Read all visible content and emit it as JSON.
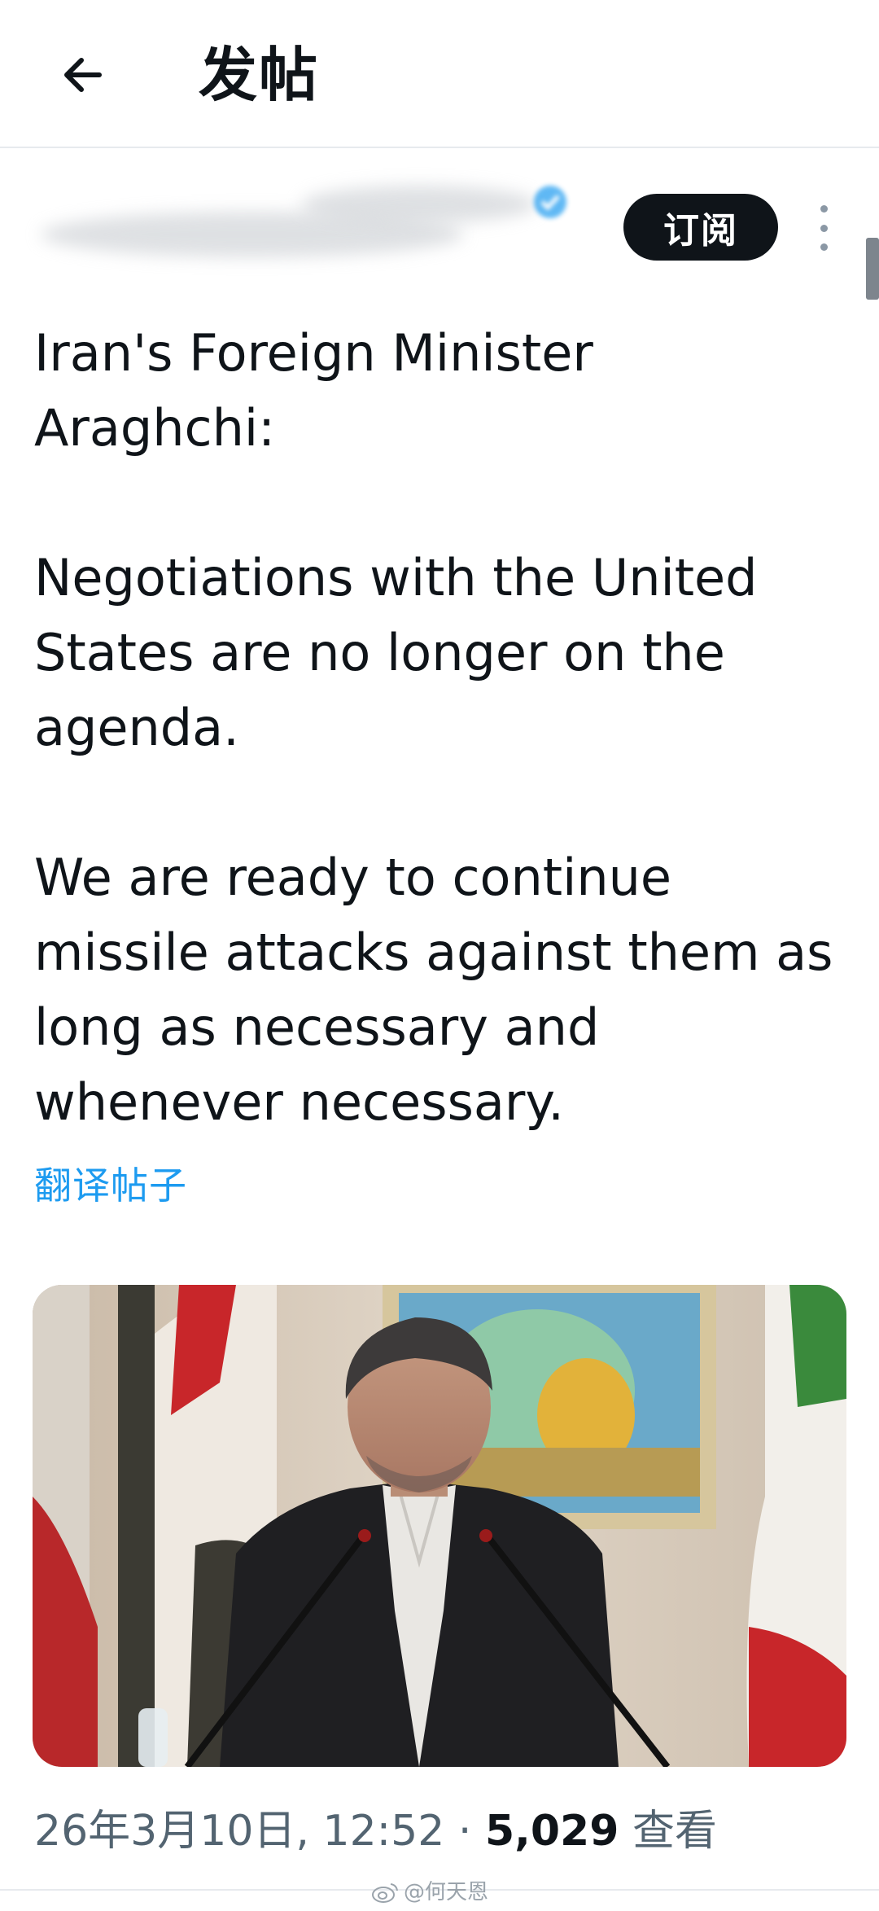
{
  "header": {
    "title": "发帖",
    "back_icon": "arrow-left-icon"
  },
  "author": {
    "verified_icon": "verified-badge-icon",
    "subscribe_label": "订阅",
    "more_icon": "more-vertical-icon"
  },
  "post": {
    "paragraphs": [
      "Iran's Foreign Minister Araghchi:",
      "Negotiations with the United States are no longer on the agenda.",
      "We are ready to continue missile attacks against them as long as necessary and whenever necessary."
    ],
    "translate_label": "翻译帖子",
    "image": {
      "icon": "photo-press-conference"
    }
  },
  "meta": {
    "timestamp": "26年3月10日, 12:52",
    "separator": "·",
    "view_count": "5,029",
    "view_label": "查看"
  },
  "watermark": {
    "text": "@何天恩",
    "icon": "weibo-icon"
  },
  "colors": {
    "text_primary": "#0f1419",
    "text_secondary": "#536471",
    "link": "#1d9bf0",
    "divider": "#e7eaee"
  }
}
